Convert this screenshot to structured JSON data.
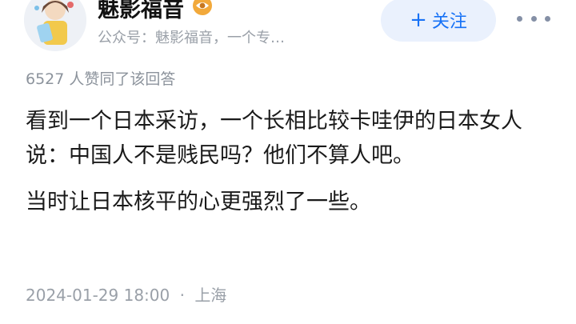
{
  "author": {
    "name": "魅影福音",
    "bio": "公众号：魅影福音，一个专…",
    "badge_icon": "eye-icon",
    "avatar_icon": "cartoon-avatar"
  },
  "actions": {
    "follow_label": "关注",
    "follow_icon": "plus-icon",
    "more_icon": "more-dots-icon"
  },
  "answer": {
    "vote_text": "6527 人赞同了该回答",
    "paragraphs": [
      "看到一个日本采访，一个长相比较卡哇伊的日本女人说：中国人不是贱民吗？他们不算人吧。",
      "当时让日本核平的心更强烈了一些。"
    ],
    "datetime": "2024-01-29 18:00",
    "separator": "·",
    "location": "上海"
  },
  "colors": {
    "accent": "#1772f6",
    "follow_bg": "#eaf1fd",
    "muted": "#9aa0a8"
  }
}
